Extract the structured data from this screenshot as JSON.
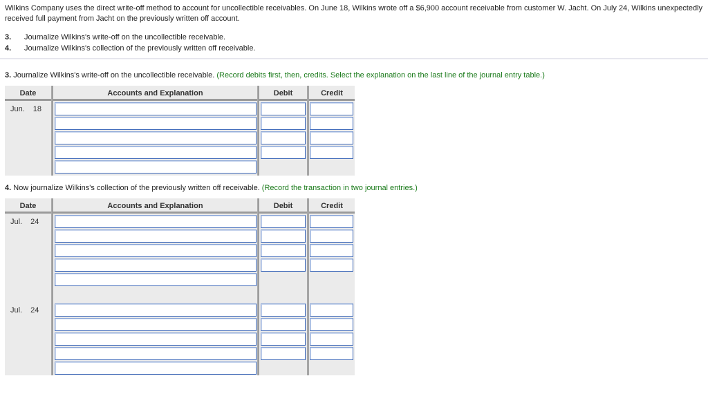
{
  "intro": "Wilkins Company uses the direct write-off method to account for uncollectible receivables. On June 18, Wilkins wrote off a $6,900 account receivable from customer W. Jacht. On July 24, Wilkins unexpectedly received full payment from Jacht on the previously written off account.",
  "requirements": [
    {
      "num": "3.",
      "text": "Journalize Wilkins's write-off on the uncollectible receivable."
    },
    {
      "num": "4.",
      "text": "Journalize Wilkins's collection of the previously written off receivable."
    }
  ],
  "q3": {
    "num": "3.",
    "text": " Journalize Wilkins's write-off on the uncollectible receivable. ",
    "hint": "(Record debits first, then, credits. Select the explanation on the last line of the journal entry table.)"
  },
  "q4": {
    "num": "4.",
    "text": " Now journalize Wilkins's collection of the previously written off receivable. ",
    "hint": "(Record the transaction in two journal entries.)"
  },
  "table_headers": {
    "date": "Date",
    "accounts": "Accounts and Explanation",
    "debit": "Debit",
    "credit": "Credit"
  },
  "table3": {
    "entries": [
      {
        "month": "Jun.",
        "day": "18",
        "lines": [
          {
            "account": "",
            "debit": "",
            "credit": ""
          },
          {
            "account": "",
            "debit": "",
            "credit": ""
          },
          {
            "account": "",
            "debit": "",
            "credit": ""
          },
          {
            "account": "",
            "debit": "",
            "credit": ""
          },
          {
            "explanation": ""
          }
        ]
      }
    ]
  },
  "table4": {
    "entries": [
      {
        "month": "Jul.",
        "day": "24",
        "lines": [
          {
            "account": "",
            "debit": "",
            "credit": ""
          },
          {
            "account": "",
            "debit": "",
            "credit": ""
          },
          {
            "account": "",
            "debit": "",
            "credit": ""
          },
          {
            "account": "",
            "debit": "",
            "credit": ""
          },
          {
            "explanation": ""
          }
        ]
      },
      {
        "month": "Jul.",
        "day": "24",
        "lines": [
          {
            "account": "",
            "debit": "",
            "credit": ""
          },
          {
            "account": "",
            "debit": "",
            "credit": ""
          },
          {
            "account": "",
            "debit": "",
            "credit": ""
          },
          {
            "account": "",
            "debit": "",
            "credit": ""
          },
          {
            "explanation": ""
          }
        ]
      }
    ]
  }
}
